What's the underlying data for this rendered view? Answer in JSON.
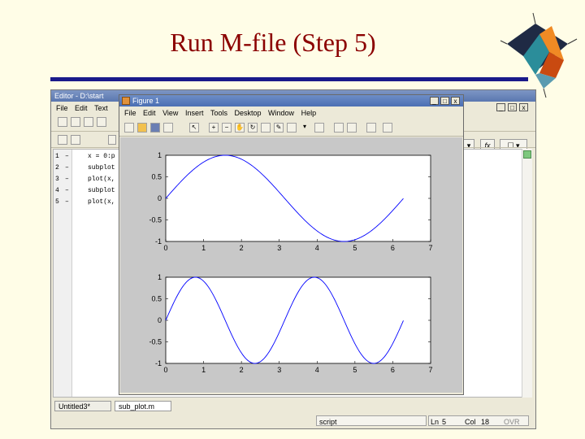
{
  "slide": {
    "title": "Run M-file (Step 5)"
  },
  "editor": {
    "title": "Editor - D:\\start",
    "menu": [
      "File",
      "Edit",
      "Text"
    ],
    "lines": [
      {
        "num": "1",
        "code": "x = 0:p"
      },
      {
        "num": "2",
        "code": "subplot"
      },
      {
        "num": "3",
        "code": "plot(x,"
      },
      {
        "num": "4",
        "code": "subplot"
      },
      {
        "num": "5",
        "code": "plot(x,"
      }
    ],
    "tabs": [
      "Untitled3*",
      "sub_plot.m"
    ],
    "status": {
      "mode": "script",
      "ln_label": "Ln",
      "ln_value": "5",
      "col_label": "Col",
      "col_value": "18",
      "ovr": "OVR"
    },
    "fx_label": "fx",
    "minimize": "_",
    "maximize": "□",
    "close": "x"
  },
  "figure": {
    "title": "Figure 1",
    "menu": [
      "File",
      "Edit",
      "View",
      "Insert",
      "Tools",
      "Desktop",
      "Window",
      "Help"
    ],
    "minimize": "_",
    "maximize": "□",
    "close": "x"
  },
  "chart_data": [
    {
      "type": "line",
      "function": "sin(x)",
      "x_range": [
        0,
        6.28
      ],
      "xlim": [
        0,
        7
      ],
      "ylim": [
        -1,
        1
      ],
      "xticks": [
        "0",
        "1",
        "2",
        "3",
        "4",
        "5",
        "6",
        "7"
      ],
      "yticks": [
        "1",
        "0.5",
        "0",
        "-0.5",
        "-1"
      ],
      "color": "#0000ff"
    },
    {
      "type": "line",
      "function": "sin(2x)",
      "x_range": [
        0,
        6.28
      ],
      "xlim": [
        0,
        7
      ],
      "ylim": [
        -1,
        1
      ],
      "xticks": [
        "0",
        "1",
        "2",
        "3",
        "4",
        "5",
        "6",
        "7"
      ],
      "yticks": [
        "1",
        "0.5",
        "0",
        "-0.5",
        "-1"
      ],
      "color": "#0000ff"
    }
  ]
}
